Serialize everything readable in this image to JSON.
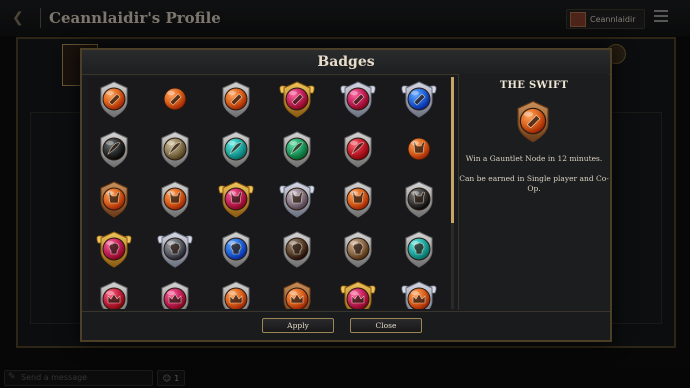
{
  "header": {
    "title": "Ceannlaidir's Profile",
    "username": "Ceannlaidir"
  },
  "chat": {
    "placeholder": "Send a message",
    "player_count": "1"
  },
  "badges_dialog": {
    "title": "Badges",
    "badges": [
      {
        "color": "#d9601a",
        "frame": "silver",
        "icon": "winged-foot"
      },
      {
        "color": "#d9601a",
        "frame": "none",
        "icon": "winged-foot"
      },
      {
        "color": "#d9601a",
        "frame": "silver",
        "icon": "winged-foot"
      },
      {
        "color": "#c0205a",
        "frame": "gold",
        "icon": "winged-foot"
      },
      {
        "color": "#c0205a",
        "frame": "winged-silver",
        "icon": "winged-foot"
      },
      {
        "color": "#1f63d6",
        "frame": "winged-silver",
        "icon": "winged-foot"
      },
      {
        "color": "#2b2e2e",
        "frame": "silver",
        "icon": "feather"
      },
      {
        "color": "#8a7a55",
        "frame": "silver",
        "icon": "feather"
      },
      {
        "color": "#1fa7a0",
        "frame": "silver",
        "icon": "feather"
      },
      {
        "color": "#1f9a62",
        "frame": "silver",
        "icon": "feather"
      },
      {
        "color": "#c01d2c",
        "frame": "silver",
        "icon": "feather"
      },
      {
        "color": "#d9601a",
        "frame": "none",
        "icon": "horned-helm"
      },
      {
        "color": "#d9601a",
        "frame": "bronze",
        "icon": "horned-helm"
      },
      {
        "color": "#d9601a",
        "frame": "silver",
        "icon": "horned-helm"
      },
      {
        "color": "#c0205a",
        "frame": "gold",
        "icon": "horned-helm"
      },
      {
        "color": "#8a7a88",
        "frame": "winged-silver",
        "icon": "horned-helm"
      },
      {
        "color": "#d9601a",
        "frame": "silver",
        "icon": "horned-helm"
      },
      {
        "color": "#3a3a3a",
        "frame": "silver",
        "icon": "horned-helm"
      },
      {
        "color": "#c0205a",
        "frame": "gold",
        "icon": "skull"
      },
      {
        "color": "#5b5f6a",
        "frame": "winged-silver",
        "icon": "skull"
      },
      {
        "color": "#1f63d6",
        "frame": "silver",
        "icon": "skull"
      },
      {
        "color": "#5b4530",
        "frame": "silver",
        "icon": "skull"
      },
      {
        "color": "#8a6a4a",
        "frame": "silver",
        "icon": "skull"
      },
      {
        "color": "#1fa7a0",
        "frame": "silver",
        "icon": "skull"
      },
      {
        "color": "#c02040",
        "frame": "silver",
        "icon": "crown"
      },
      {
        "color": "#c0205a",
        "frame": "silver",
        "icon": "crown"
      },
      {
        "color": "#d9601a",
        "frame": "silver",
        "icon": "crown"
      },
      {
        "color": "#d9601a",
        "frame": "bronze",
        "icon": "crown"
      },
      {
        "color": "#c0205a",
        "frame": "gold",
        "icon": "crown"
      },
      {
        "color": "#d9601a",
        "frame": "winged-silver",
        "icon": "crown"
      }
    ],
    "selected": {
      "name": "THE SWIFT",
      "description": "Win a Gauntlet Node in 12 minutes.",
      "note": "Can be earned in Single player and Co-Op.",
      "color": "#d9601a"
    },
    "apply_label": "Apply",
    "close_label": "Close",
    "scroll_fraction": 0.63
  }
}
